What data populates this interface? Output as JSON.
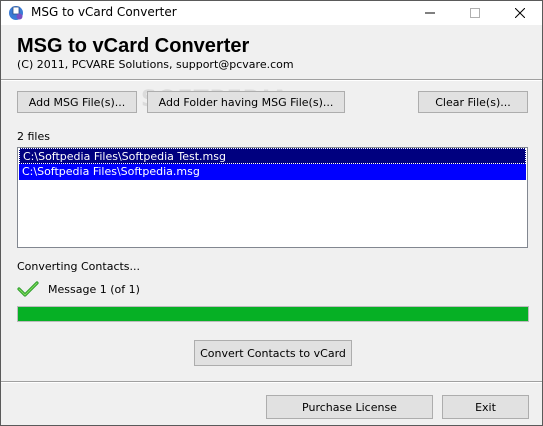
{
  "window": {
    "title": "MSG to vCard Converter",
    "icon": "app-icon"
  },
  "header": {
    "title": "MSG to vCard Converter",
    "subtitle": "(C) 2011, PCVARE Solutions, support@pcvare.com"
  },
  "toolbar": {
    "add_msg_label": "Add MSG File(s)...",
    "add_folder_label": "Add Folder having MSG File(s)...",
    "clear_label": "Clear File(s)..."
  },
  "files": {
    "count_label": "2 files",
    "items": [
      {
        "path": "C:\\Softpedia Files\\Softpedia Test.msg",
        "selected": true
      },
      {
        "path": "C:\\Softpedia Files\\Softpedia.msg",
        "selected": true
      }
    ]
  },
  "status": {
    "converting_label": "Converting Contacts...",
    "message_label": "Message 1 (of 1)",
    "progress": 1.0,
    "progress_color": "#06b025"
  },
  "actions": {
    "convert_label": "Convert Contacts to vCard",
    "purchase_label": "Purchase License",
    "exit_label": "Exit"
  }
}
